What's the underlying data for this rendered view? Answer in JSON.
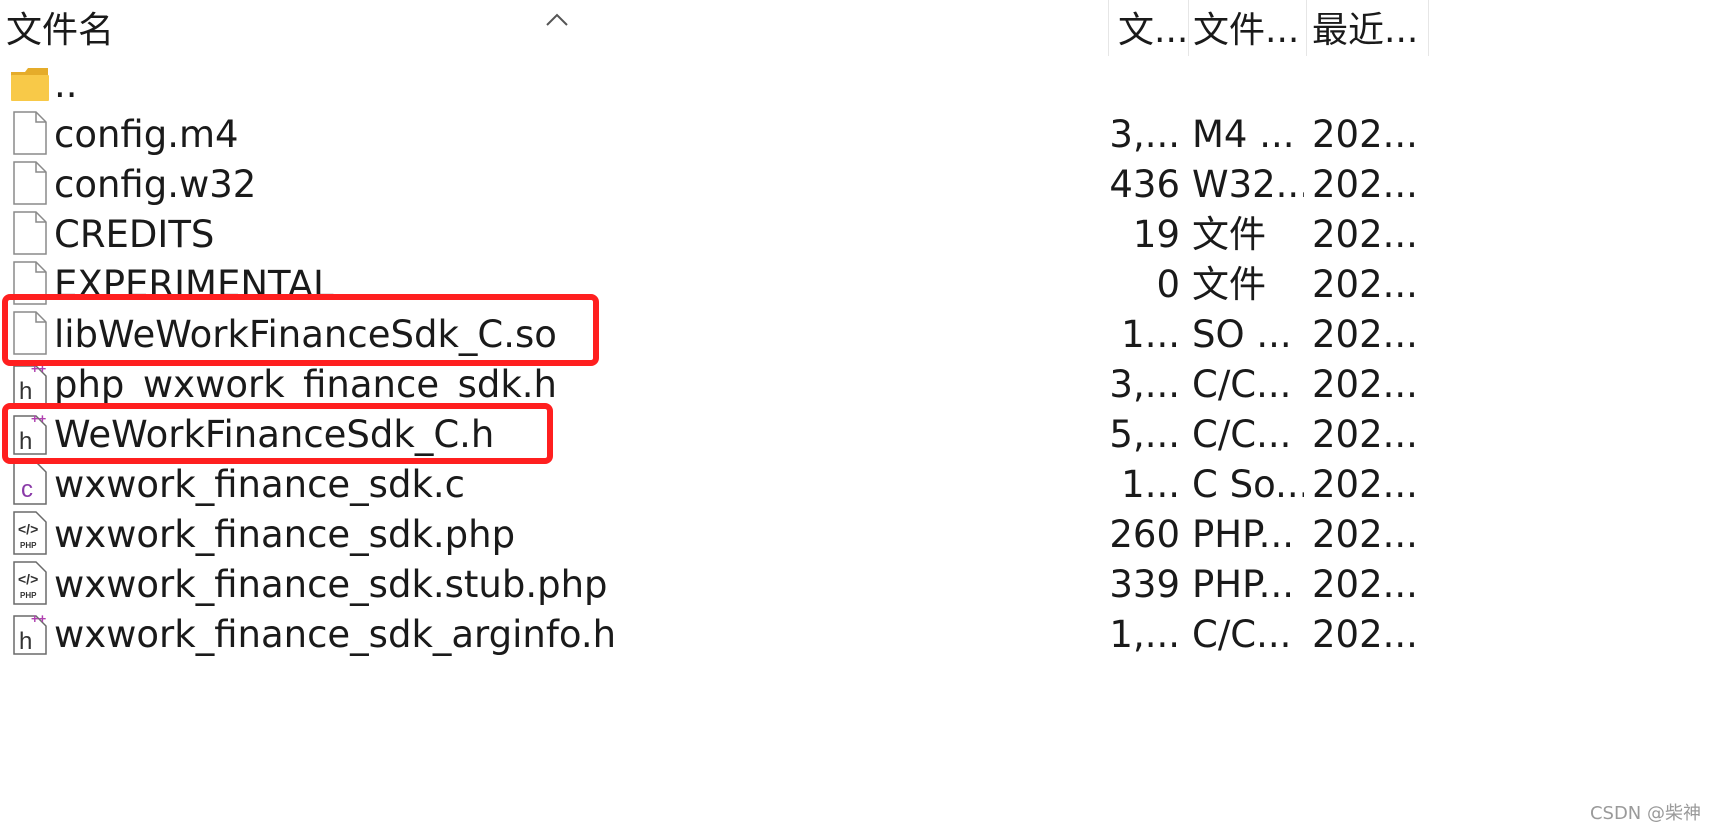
{
  "header": {
    "name": "文件名",
    "size": "文...",
    "type": "文件...",
    "modified": "最近..."
  },
  "files": [
    {
      "name": "..",
      "size": "",
      "type": "",
      "modified": "",
      "icon": "folder-icon"
    },
    {
      "name": "config.m4",
      "size": "3,...",
      "type": "M4 ...",
      "modified": "202...",
      "icon": "file-icon"
    },
    {
      "name": "config.w32",
      "size": "436",
      "type": "W32...",
      "modified": "202...",
      "icon": "file-icon"
    },
    {
      "name": "CREDITS",
      "size": "19",
      "type": "文件",
      "modified": "202...",
      "icon": "file-icon"
    },
    {
      "name": "EXPERIMENTAL",
      "size": "0",
      "type": "文件",
      "modified": "202...",
      "icon": "file-icon"
    },
    {
      "name": "libWeWorkFinanceSdk_C.so",
      "size": "1...",
      "type": "SO ...",
      "modified": "202...",
      "icon": "file-icon"
    },
    {
      "name": "php_wxwork_finance_sdk.h",
      "size": "3,...",
      "type": "C/C...",
      "modified": "202...",
      "icon": "header-file-icon"
    },
    {
      "name": "WeWorkFinanceSdk_C.h",
      "size": "5,...",
      "type": "C/C...",
      "modified": "202...",
      "icon": "header-file-icon"
    },
    {
      "name": "wxwork_finance_sdk.c",
      "size": "1...",
      "type": "C So...",
      "modified": "202...",
      "icon": "c-source-file-icon"
    },
    {
      "name": "wxwork_finance_sdk.php",
      "size": "260",
      "type": "PHP...",
      "modified": "202...",
      "icon": "php-file-icon"
    },
    {
      "name": "wxwork_finance_sdk.stub.php",
      "size": "339",
      "type": "PHP...",
      "modified": "202...",
      "icon": "php-file-icon"
    },
    {
      "name": "wxwork_finance_sdk_arginfo.h",
      "size": "1,...",
      "type": "C/C...",
      "modified": "202...",
      "icon": "header-file-icon"
    }
  ],
  "annotations": {
    "highlight_color": "#ff1f1f",
    "highlighted_files": [
      "libWeWorkFinanceSdk_C.so",
      "WeWorkFinanceSdk_C.h"
    ]
  },
  "watermark": "CSDN @柴神",
  "colors": {
    "folder": "#f8c948",
    "header_accent": "#b040b0",
    "c_accent": "#8a3aa8"
  }
}
